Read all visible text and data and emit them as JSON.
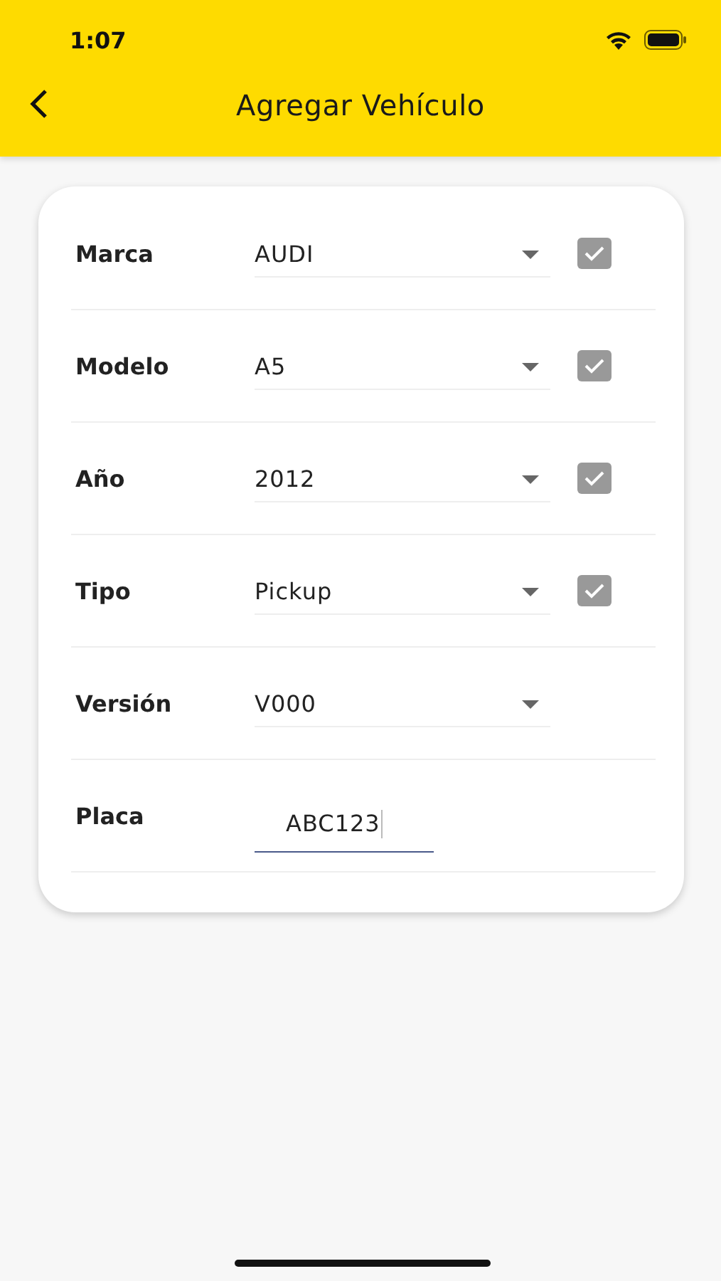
{
  "status_bar": {
    "time": "1:07"
  },
  "header": {
    "title": "Agregar Vehículo"
  },
  "fields": [
    {
      "kind": "dropdown",
      "label": "Marca",
      "value": "AUDI",
      "confirmed": true
    },
    {
      "kind": "dropdown",
      "label": "Modelo",
      "value": "A5",
      "confirmed": true
    },
    {
      "kind": "dropdown",
      "label": "Año",
      "value": "2012",
      "confirmed": true
    },
    {
      "kind": "dropdown",
      "label": "Tipo",
      "value": "Pickup",
      "confirmed": true
    },
    {
      "kind": "dropdown",
      "label": "Versión",
      "value": "V000",
      "confirmed": false
    },
    {
      "kind": "text",
      "label": "Placa",
      "value": "ABC123",
      "focused": true
    }
  ]
}
